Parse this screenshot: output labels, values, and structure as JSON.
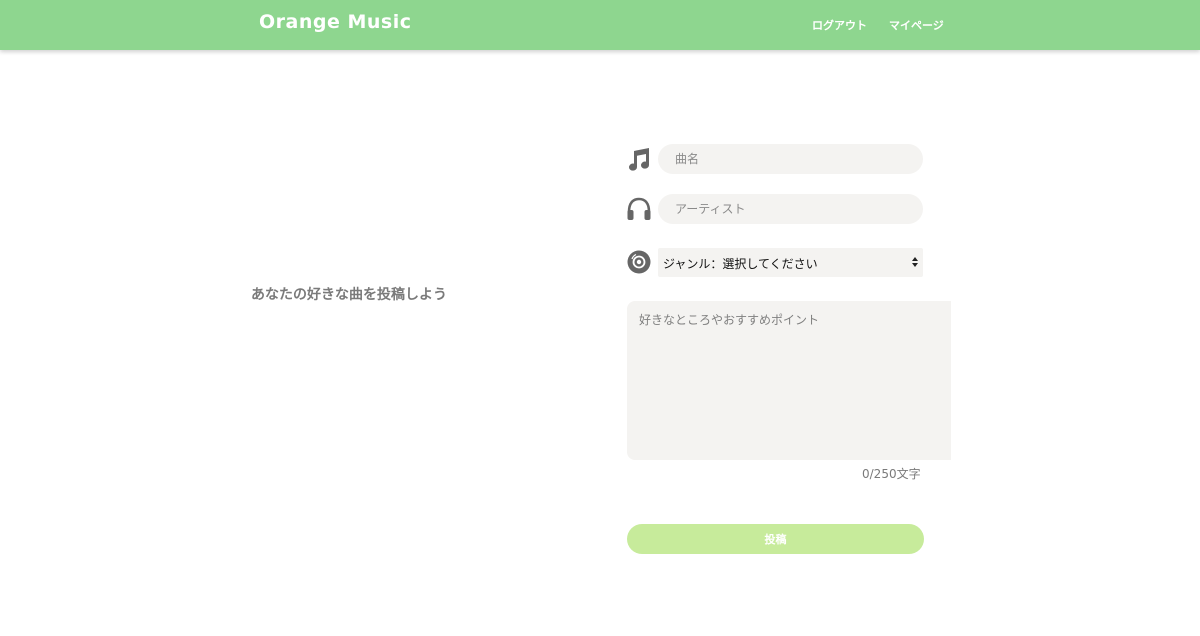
{
  "header": {
    "brand": "Orange Music",
    "nav": {
      "logout": "ログアウト",
      "mypage": "マイページ"
    },
    "background_color": "#8ed68f"
  },
  "main": {
    "lead_text": "あなたの好きな曲を投稿しよう",
    "form": {
      "title_field": {
        "placeholder": "曲名",
        "value": "",
        "icon": "music-note-icon"
      },
      "artist_field": {
        "placeholder": "アーティスト",
        "value": "",
        "icon": "headphones-icon"
      },
      "genre_select": {
        "selected": "ジャンル：選択してください",
        "icon": "disc-icon"
      },
      "comment_field": {
        "placeholder": "好きなところやおすすめポイント",
        "value": ""
      },
      "counter": "0/250文字",
      "submit_label": "投稿",
      "submit_color": "#c7eb9b"
    }
  }
}
